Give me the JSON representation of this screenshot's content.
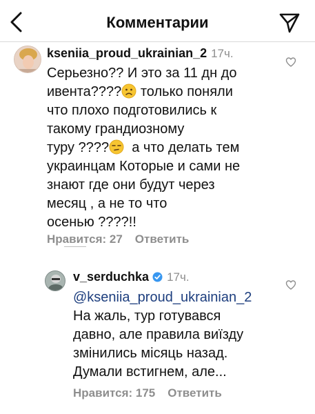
{
  "header": {
    "title": "Комментарии",
    "back_icon": "chevron-left-icon",
    "send_icon": "paper-plane-icon"
  },
  "comments": [
    {
      "username": "kseniia_proud_ukrainian_2",
      "time": "17ч.",
      "text_parts": [
        "Серьезно?? И это за 11 дн до\nивента????",
        " только поняли\nчто плохо подготовились к\nтакому грандиозному\nтуру ????",
        "  а что делать тем\nукраинцам Которые и сами не\nзнают где они будут через\nмесяц , а не то что\nосенью ????!!"
      ],
      "likes": "Нравится: 27",
      "reply": "Ответить",
      "emoji_icons": [
        "frowning-face-emoji-icon",
        "unamused-face-emoji-icon"
      ]
    },
    {
      "username": "v_serduchka",
      "time": "17ч.",
      "verified": true,
      "mention": "@kseniia_proud_ukrainian_2",
      "text": "На жаль, тур готувався\nдавно, але правила виїзду\nзмінились місяць назад.\nДумали встигнем, але...",
      "likes": "Нравится: 175",
      "reply": "Ответить"
    }
  ],
  "colors": {
    "text": "#111111",
    "muted": "#8e8e8e",
    "mention": "#1d3e7e",
    "verified": "#3897f0"
  }
}
